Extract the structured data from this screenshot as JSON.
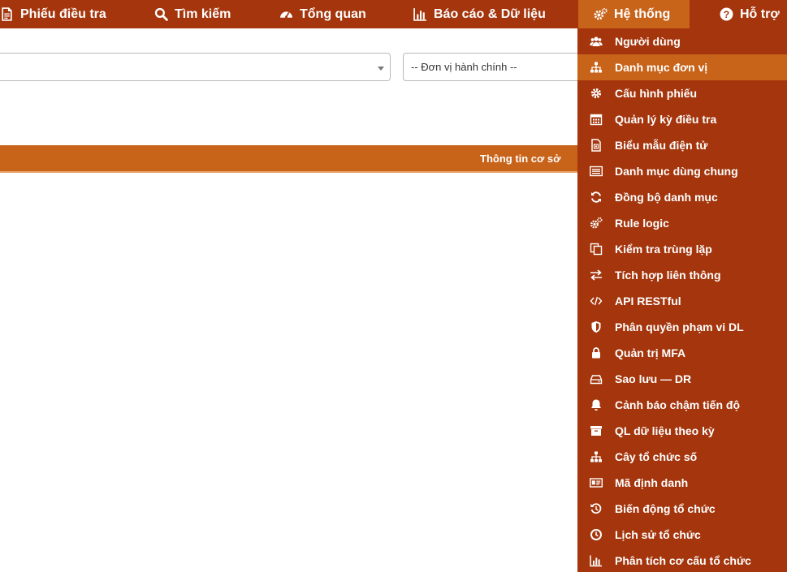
{
  "navbar": {
    "items": [
      {
        "label": "Phiếu điều tra",
        "icon": "document-icon"
      },
      {
        "label": "Tìm kiếm",
        "icon": "search-icon"
      },
      {
        "label": "Tổng quan",
        "icon": "dashboard-icon"
      },
      {
        "label": "Báo cáo & Dữ liệu",
        "icon": "bar-chart-icon"
      },
      {
        "label": "Hệ thống",
        "icon": "gears-icon",
        "active": true
      },
      {
        "label": "Hỗ trợ",
        "icon": "help-icon"
      }
    ]
  },
  "filters": {
    "main_select_value": "",
    "unit_select_value": "-- Đơn vị hành chính --"
  },
  "info_bar": {
    "title": "Thông tin cơ sở"
  },
  "system_menu": {
    "items": [
      {
        "label": "Người dùng",
        "icon": "users-icon"
      },
      {
        "label": "Danh mục đơn vị",
        "icon": "sitemap-icon",
        "active": true
      },
      {
        "label": "Cấu hình phiếu",
        "icon": "gear-icon"
      },
      {
        "label": "Quản lý kỳ điều tra",
        "icon": "calendar-icon"
      },
      {
        "label": "Biểu mẫu điện tử",
        "icon": "file-form-icon"
      },
      {
        "label": "Danh mục dùng chung",
        "icon": "list-icon"
      },
      {
        "label": "Đồng bộ danh mục",
        "icon": "sync-icon"
      },
      {
        "label": "Rule logic",
        "icon": "cogs-icon"
      },
      {
        "label": "Kiểm tra trùng lặp",
        "icon": "copy-icon"
      },
      {
        "label": "Tích hợp liên thông",
        "icon": "exchange-icon"
      },
      {
        "label": "API RESTful",
        "icon": "code-icon"
      },
      {
        "label": "Phân quyền phạm vi DL",
        "icon": "shield-icon"
      },
      {
        "label": "Quản trị MFA",
        "icon": "lock-icon"
      },
      {
        "label": "Sao lưu — DR",
        "icon": "hdd-icon"
      },
      {
        "label": "Cảnh báo chậm tiến độ",
        "icon": "bell-icon"
      },
      {
        "label": "QL dữ liệu theo kỳ",
        "icon": "archive-icon"
      },
      {
        "label": "Cây tổ chức số",
        "icon": "sitemap-icon"
      },
      {
        "label": "Mã định danh",
        "icon": "id-card-icon"
      },
      {
        "label": "Biến động tổ chức",
        "icon": "history-icon"
      },
      {
        "label": "Lịch sử tổ chức",
        "icon": "clock-icon"
      },
      {
        "label": "Phân tích cơ cấu tổ chức",
        "icon": "bar-chart-icon"
      }
    ]
  },
  "colors": {
    "nav_bg": "#a4350c",
    "accent": "#c8631a",
    "text_on_dark": "#ffffff"
  }
}
